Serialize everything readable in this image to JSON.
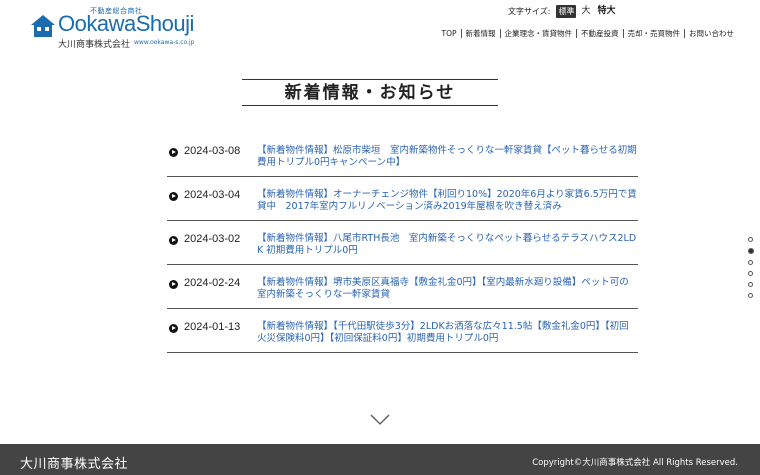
{
  "header": {
    "tagline": "不動産総合商社",
    "brand": "OokawaShouji",
    "company": "大川商事株式会社",
    "url": "www.ookawa-s.co.jp",
    "font_size": {
      "label": "文字サイズ:",
      "options": [
        "標準",
        "大",
        "特大"
      ]
    },
    "nav": [
      "TOP",
      "新着情報",
      "企業理念・賃貸物件",
      "不動産投資",
      "売却・売買物件",
      "お問い合わせ"
    ]
  },
  "main": {
    "title": "新着情報・お知らせ",
    "news": [
      {
        "date": "2024-03-08",
        "text": "【新着物件情報】松原市柴垣　室内新築物件そっくりな一軒家賃貸【ペット暮らせる初期費用トリプル0円キャンペーン中】"
      },
      {
        "date": "2024-03-04",
        "text": "【新着物件情報】オーナーチェンジ物件【利回り10%】2020年6月より家賃6.5万円で賃貸中　2017年室内フルリノベーション済み2019年屋根を吹き替え済み"
      },
      {
        "date": "2024-03-02",
        "text": "【新着物件情報】八尾市RTH長池　室内新築そっくりなペット暮らせるテラスハウス2LDK 初期費用トリプル0円"
      },
      {
        "date": "2024-02-24",
        "text": "【新着物件情報】堺市美原区真福寺【敷金礼金0円】【室内最新水廻り設備】ペット可の室内新築そっくりな一軒家賃貸"
      },
      {
        "date": "2024-01-13",
        "text": "【新着物件情報】【千代田駅徒歩3分】2LDKお洒落な広々11.5帖【敷金礼金0円】【初回火災保険料0円】【初回保証料0円】初期費用トリプル0円"
      }
    ]
  },
  "footer": {
    "company": "大川商事株式会社",
    "copyright": "Copyright©大川商事株式会社 All Rights Reserved."
  },
  "colors": {
    "brand": "#1b6cae",
    "link": "#2a64b3",
    "footer_bg": "#444444"
  }
}
